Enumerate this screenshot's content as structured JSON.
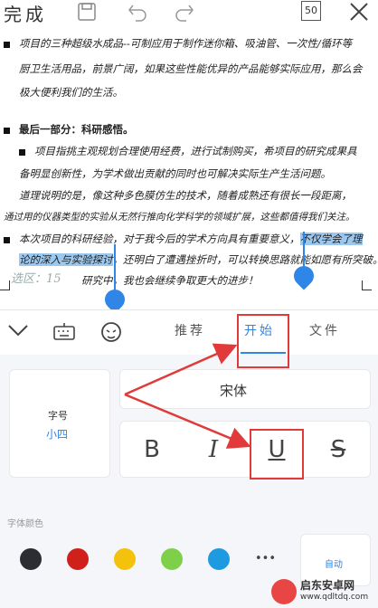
{
  "topbar": {
    "done_label": "完成",
    "page_count": "50",
    "icons": [
      "save-icon",
      "undo-icon",
      "redo-icon",
      "close-icon"
    ]
  },
  "document": {
    "lines": [
      {
        "text": "项目的三种超级水成品--可制应用于制作迷你箱、吸油管、一次性/循环等",
        "bullet": true
      },
      {
        "text": "厨卫生活用品，前景广阔，如果这些性能优异的产品能够实际应用，那么会",
        "bullet": false
      },
      {
        "text": "极大便利我们的生活。",
        "bullet": false
      },
      {
        "text": "最后一部分：科研感悟。",
        "bullet": true,
        "bold": true
      },
      {
        "text": "项目指挑主观规划合理使用经费，进行试制购买，希项目的研究成果具",
        "bullet": true
      },
      {
        "text": "备明显创新性，为学术做出贡献的同时也可解决实际生产生活问题。",
        "bullet": false
      },
      {
        "text": "道理说明的是，像这种多色膜仿生的技术，随着成熟还有很长一段距离，",
        "bullet": false
      },
      {
        "text": "通过用的仪器类型的实验从无然行推向化学科学的领域扩展，这些都值得我们关注。",
        "bullet": false
      },
      {
        "text_before": "本次项目的科研经验，对于我今后的学术方向具有重要意义，",
        "selected_1": "不仅学会了理",
        "bullet": true
      },
      {
        "selected_2": "论的深入与实验探讨",
        "text_after": "，还明白了遭遇挫折时，可以转换思路就能如愿有所突破。",
        "bullet": false
      },
      {
        "text": "研究中，我也会继续争取更大的进步！",
        "bullet": false
      }
    ],
    "word_counter": "选区：15"
  },
  "toolbar": {
    "tabs": [
      "推荐",
      "开始",
      "文件"
    ],
    "active_tab": "开始"
  },
  "panel": {
    "font_size_label": "字号",
    "font_size_value": "小四",
    "font_name": "宋体",
    "format_buttons": [
      "B",
      "I",
      "U",
      "S"
    ],
    "font_color_label": "字体颜色",
    "colors": [
      "#2b2d33",
      "#d0201b",
      "#f4c20d",
      "#7ed04b",
      "#1e9be0"
    ],
    "more_label": "•••",
    "auto_label": "自动"
  },
  "watermark": {
    "brand": "启东安卓网",
    "url": "www.qdltdq.com"
  },
  "colors": {
    "accent": "#2f86e6",
    "annotation": "#e03a3a"
  }
}
